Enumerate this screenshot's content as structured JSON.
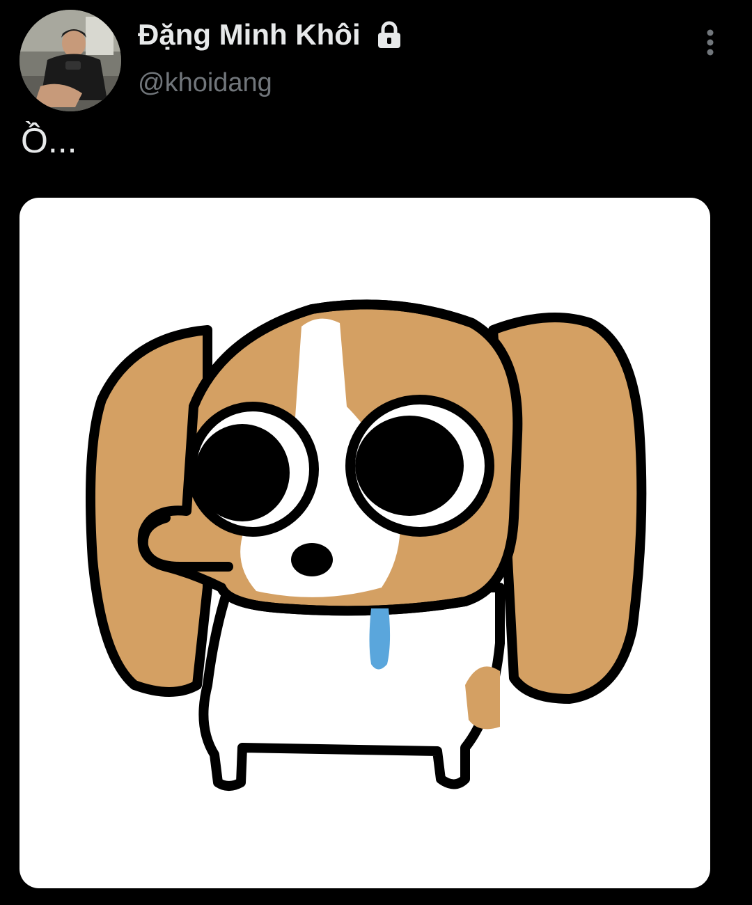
{
  "tweet": {
    "author": {
      "display_name": "Đặng Minh Khôi",
      "handle": "@khoidang",
      "protected_icon": "lock-icon",
      "avatar_icon": "avatar-photo"
    },
    "text": "Ồ...",
    "more_icon": "more-vertical-icon",
    "media": {
      "type": "image",
      "subject": "cartoon-dog-sticker"
    }
  },
  "colors": {
    "background": "#000000",
    "name_text": "#e7e9ea",
    "handle_text": "#71767b",
    "dog_fur": "#d4a063",
    "dog_outline": "#000000",
    "drool": "#5aa6dc",
    "media_bg": "#ffffff"
  }
}
